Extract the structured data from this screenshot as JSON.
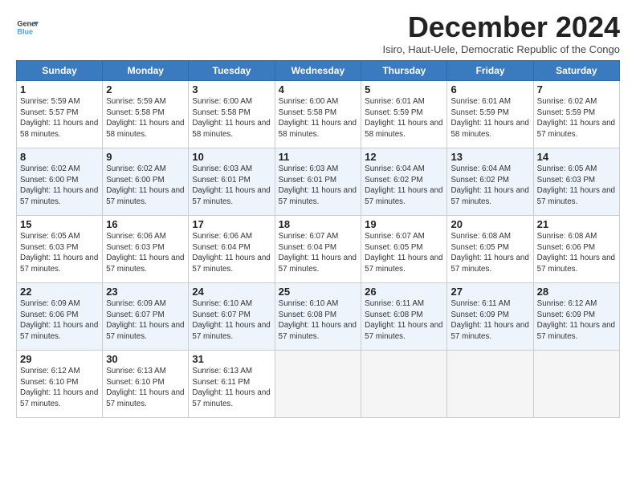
{
  "logo": {
    "line1": "General",
    "line2": "Blue"
  },
  "title": "December 2024",
  "subtitle": "Isiro, Haut-Uele, Democratic Republic of the Congo",
  "weekdays": [
    "Sunday",
    "Monday",
    "Tuesday",
    "Wednesday",
    "Thursday",
    "Friday",
    "Saturday"
  ],
  "weeks": [
    [
      {
        "day": "1",
        "rise": "Sunrise: 5:59 AM",
        "set": "Sunset: 5:57 PM",
        "daylight": "Daylight: 11 hours and 58 minutes."
      },
      {
        "day": "2",
        "rise": "Sunrise: 5:59 AM",
        "set": "Sunset: 5:58 PM",
        "daylight": "Daylight: 11 hours and 58 minutes."
      },
      {
        "day": "3",
        "rise": "Sunrise: 6:00 AM",
        "set": "Sunset: 5:58 PM",
        "daylight": "Daylight: 11 hours and 58 minutes."
      },
      {
        "day": "4",
        "rise": "Sunrise: 6:00 AM",
        "set": "Sunset: 5:58 PM",
        "daylight": "Daylight: 11 hours and 58 minutes."
      },
      {
        "day": "5",
        "rise": "Sunrise: 6:01 AM",
        "set": "Sunset: 5:59 PM",
        "daylight": "Daylight: 11 hours and 58 minutes."
      },
      {
        "day": "6",
        "rise": "Sunrise: 6:01 AM",
        "set": "Sunset: 5:59 PM",
        "daylight": "Daylight: 11 hours and 58 minutes."
      },
      {
        "day": "7",
        "rise": "Sunrise: 6:02 AM",
        "set": "Sunset: 5:59 PM",
        "daylight": "Daylight: 11 hours and 57 minutes."
      }
    ],
    [
      {
        "day": "8",
        "rise": "Sunrise: 6:02 AM",
        "set": "Sunset: 6:00 PM",
        "daylight": "Daylight: 11 hours and 57 minutes."
      },
      {
        "day": "9",
        "rise": "Sunrise: 6:02 AM",
        "set": "Sunset: 6:00 PM",
        "daylight": "Daylight: 11 hours and 57 minutes."
      },
      {
        "day": "10",
        "rise": "Sunrise: 6:03 AM",
        "set": "Sunset: 6:01 PM",
        "daylight": "Daylight: 11 hours and 57 minutes."
      },
      {
        "day": "11",
        "rise": "Sunrise: 6:03 AM",
        "set": "Sunset: 6:01 PM",
        "daylight": "Daylight: 11 hours and 57 minutes."
      },
      {
        "day": "12",
        "rise": "Sunrise: 6:04 AM",
        "set": "Sunset: 6:02 PM",
        "daylight": "Daylight: 11 hours and 57 minutes."
      },
      {
        "day": "13",
        "rise": "Sunrise: 6:04 AM",
        "set": "Sunset: 6:02 PM",
        "daylight": "Daylight: 11 hours and 57 minutes."
      },
      {
        "day": "14",
        "rise": "Sunrise: 6:05 AM",
        "set": "Sunset: 6:03 PM",
        "daylight": "Daylight: 11 hours and 57 minutes."
      }
    ],
    [
      {
        "day": "15",
        "rise": "Sunrise: 6:05 AM",
        "set": "Sunset: 6:03 PM",
        "daylight": "Daylight: 11 hours and 57 minutes."
      },
      {
        "day": "16",
        "rise": "Sunrise: 6:06 AM",
        "set": "Sunset: 6:03 PM",
        "daylight": "Daylight: 11 hours and 57 minutes."
      },
      {
        "day": "17",
        "rise": "Sunrise: 6:06 AM",
        "set": "Sunset: 6:04 PM",
        "daylight": "Daylight: 11 hours and 57 minutes."
      },
      {
        "day": "18",
        "rise": "Sunrise: 6:07 AM",
        "set": "Sunset: 6:04 PM",
        "daylight": "Daylight: 11 hours and 57 minutes."
      },
      {
        "day": "19",
        "rise": "Sunrise: 6:07 AM",
        "set": "Sunset: 6:05 PM",
        "daylight": "Daylight: 11 hours and 57 minutes."
      },
      {
        "day": "20",
        "rise": "Sunrise: 6:08 AM",
        "set": "Sunset: 6:05 PM",
        "daylight": "Daylight: 11 hours and 57 minutes."
      },
      {
        "day": "21",
        "rise": "Sunrise: 6:08 AM",
        "set": "Sunset: 6:06 PM",
        "daylight": "Daylight: 11 hours and 57 minutes."
      }
    ],
    [
      {
        "day": "22",
        "rise": "Sunrise: 6:09 AM",
        "set": "Sunset: 6:06 PM",
        "daylight": "Daylight: 11 hours and 57 minutes."
      },
      {
        "day": "23",
        "rise": "Sunrise: 6:09 AM",
        "set": "Sunset: 6:07 PM",
        "daylight": "Daylight: 11 hours and 57 minutes."
      },
      {
        "day": "24",
        "rise": "Sunrise: 6:10 AM",
        "set": "Sunset: 6:07 PM",
        "daylight": "Daylight: 11 hours and 57 minutes."
      },
      {
        "day": "25",
        "rise": "Sunrise: 6:10 AM",
        "set": "Sunset: 6:08 PM",
        "daylight": "Daylight: 11 hours and 57 minutes."
      },
      {
        "day": "26",
        "rise": "Sunrise: 6:11 AM",
        "set": "Sunset: 6:08 PM",
        "daylight": "Daylight: 11 hours and 57 minutes."
      },
      {
        "day": "27",
        "rise": "Sunrise: 6:11 AM",
        "set": "Sunset: 6:09 PM",
        "daylight": "Daylight: 11 hours and 57 minutes."
      },
      {
        "day": "28",
        "rise": "Sunrise: 6:12 AM",
        "set": "Sunset: 6:09 PM",
        "daylight": "Daylight: 11 hours and 57 minutes."
      }
    ],
    [
      {
        "day": "29",
        "rise": "Sunrise: 6:12 AM",
        "set": "Sunset: 6:10 PM",
        "daylight": "Daylight: 11 hours and 57 minutes."
      },
      {
        "day": "30",
        "rise": "Sunrise: 6:13 AM",
        "set": "Sunset: 6:10 PM",
        "daylight": "Daylight: 11 hours and 57 minutes."
      },
      {
        "day": "31",
        "rise": "Sunrise: 6:13 AM",
        "set": "Sunset: 6:11 PM",
        "daylight": "Daylight: 11 hours and 57 minutes."
      },
      null,
      null,
      null,
      null
    ]
  ]
}
